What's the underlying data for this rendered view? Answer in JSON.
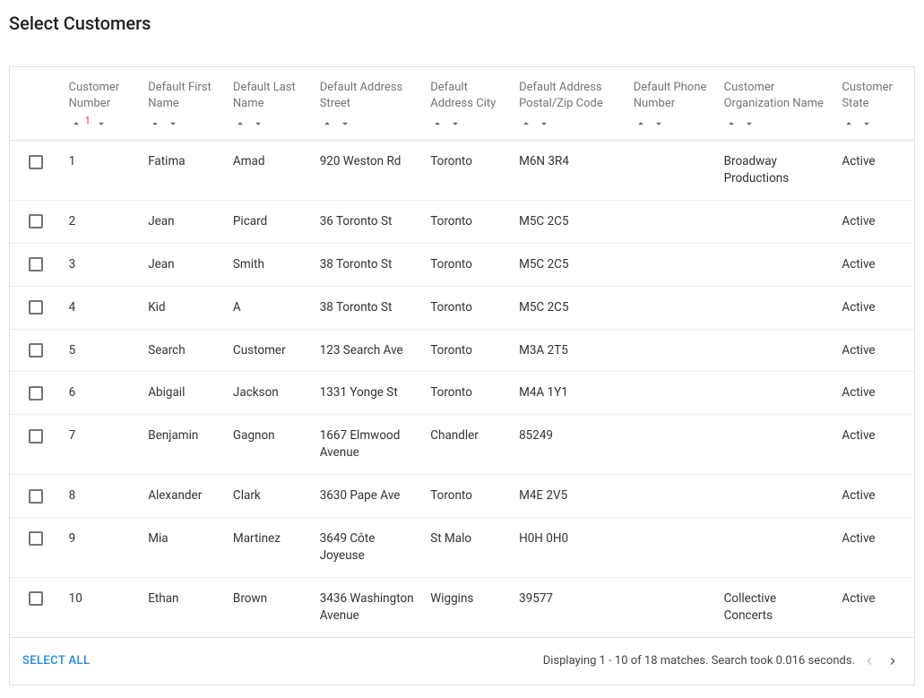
{
  "title": "Select Customers",
  "columns": {
    "customerNumber": "Customer Number",
    "firstName": "Default First Name",
    "lastName": "Default Last Name",
    "street": "Default Address Street",
    "city": "Default Address City",
    "postal": "Default Address Postal/Zip Code",
    "phone": "Default Phone Number",
    "organization": "Customer Organization Name",
    "state": "Customer State"
  },
  "sort": {
    "activeIndex": "1"
  },
  "rows": [
    {
      "number": "1",
      "firstName": "Fatima",
      "lastName": "Amad",
      "street": "920 Weston Rd",
      "city": "Toronto",
      "postal": "M6N 3R4",
      "phone": "",
      "organization": "Broadway Productions",
      "state": "Active"
    },
    {
      "number": "2",
      "firstName": "Jean",
      "lastName": "Picard",
      "street": "36 Toronto St",
      "city": "Toronto",
      "postal": "M5C 2C5",
      "phone": "",
      "organization": "",
      "state": "Active"
    },
    {
      "number": "3",
      "firstName": "Jean",
      "lastName": "Smith",
      "street": "38 Toronto St",
      "city": "Toronto",
      "postal": "M5C 2C5",
      "phone": "",
      "organization": "",
      "state": "Active"
    },
    {
      "number": "4",
      "firstName": "Kid",
      "lastName": "A",
      "street": "38 Toronto St",
      "city": "Toronto",
      "postal": "M5C 2C5",
      "phone": "",
      "organization": "",
      "state": "Active"
    },
    {
      "number": "5",
      "firstName": "Search",
      "lastName": "Customer",
      "street": "123 Search Ave",
      "city": "Toronto",
      "postal": "M3A 2T5",
      "phone": "",
      "organization": "",
      "state": "Active"
    },
    {
      "number": "6",
      "firstName": "Abigail",
      "lastName": "Jackson",
      "street": "1331 Yonge St",
      "city": "Toronto",
      "postal": "M4A 1Y1",
      "phone": "",
      "organization": "",
      "state": "Active"
    },
    {
      "number": "7",
      "firstName": "Benjamin",
      "lastName": "Gagnon",
      "street": "1667 Elmwood Avenue",
      "city": "Chandler",
      "postal": "85249",
      "phone": "",
      "organization": "",
      "state": "Active"
    },
    {
      "number": "8",
      "firstName": "Alexander",
      "lastName": "Clark",
      "street": "3630 Pape Ave",
      "city": "Toronto",
      "postal": "M4E 2V5",
      "phone": "",
      "organization": "",
      "state": "Active"
    },
    {
      "number": "9",
      "firstName": "Mia",
      "lastName": "Martinez",
      "street": "3649 Côte Joyeuse",
      "city": "St Malo",
      "postal": "H0H 0H0",
      "phone": "",
      "organization": "",
      "state": "Active"
    },
    {
      "number": "10",
      "firstName": "Ethan",
      "lastName": "Brown",
      "street": "3436 Washington Avenue",
      "city": "Wiggins",
      "postal": "39577",
      "phone": "",
      "organization": "Collective Concerts",
      "state": "Active"
    }
  ],
  "footer": {
    "selectAll": "SELECT ALL",
    "displayText": "Displaying 1 - 10 of 18 matches. Search took 0.016 seconds."
  }
}
